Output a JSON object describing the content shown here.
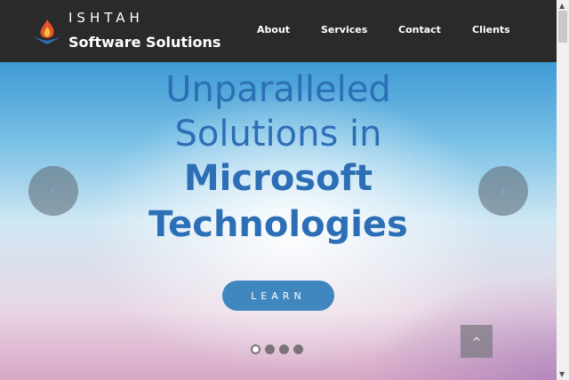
{
  "brand": {
    "name_top": "ISHTAH",
    "name_bottom": "Software Solutions",
    "logo_icon": "flame-logo-icon"
  },
  "nav": {
    "items": [
      {
        "label": "About"
      },
      {
        "label": "Services"
      },
      {
        "label": "Contact"
      },
      {
        "label": "Clients"
      }
    ]
  },
  "hero": {
    "line1": "Unparalleled",
    "line2": "Solutions in",
    "line3": "Microsoft",
    "line4": "Technologies",
    "button_label": "LEARN",
    "prev_icon": "‹",
    "next_icon": "›",
    "slide_count": 4,
    "active_slide": 1
  },
  "to_top_icon": "^",
  "colors": {
    "navbar": "#2a2a2a",
    "headline": "#2d6fb6",
    "button": "#4187bf"
  }
}
